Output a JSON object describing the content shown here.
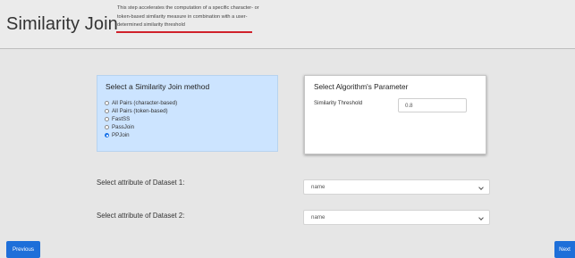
{
  "header": {
    "title": "Similarity Join",
    "description": "This step accelerates the computation of a specific character- or token-based similarity measure in combination with a user-determined similarity threshold"
  },
  "method_panel": {
    "heading": "Select a Similarity Join method",
    "options": [
      {
        "label": "All Pairs (character-based)",
        "checked": false
      },
      {
        "label": "All Pairs (token-based)",
        "checked": false
      },
      {
        "label": "FastSS",
        "checked": false
      },
      {
        "label": "PassJoin",
        "checked": false
      },
      {
        "label": "PPJoin",
        "checked": true
      }
    ]
  },
  "param_panel": {
    "heading": "Select Algorithm's Parameter",
    "threshold_label": "Similarity Threshold",
    "threshold_value": "0.8"
  },
  "attributes": {
    "dataset1_label": "Select attribute of Dataset 1:",
    "dataset1_value": "name",
    "dataset2_label": "Select attribute of Dataset 2:",
    "dataset2_value": "name"
  },
  "nav": {
    "previous_label": "Previous",
    "next_label": "Next"
  },
  "colors": {
    "accent": "#1e6fd9",
    "method_panel_bg": "#cce4ff",
    "title_underline": "#d0212b"
  },
  "icons": {
    "select_arrow": "chevron-down-icon"
  }
}
